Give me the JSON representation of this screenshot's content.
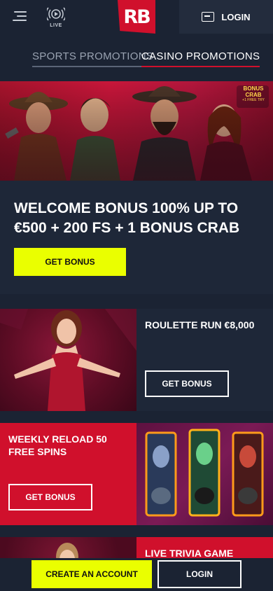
{
  "header": {
    "live_label": "LIVE",
    "logo_text": "RB",
    "login_label": "LOGIN"
  },
  "tabs": [
    {
      "label": "SPORTS PROMOTIONS",
      "active": false
    },
    {
      "label": "CASINO PROMOTIONS",
      "active": true
    }
  ],
  "hero": {
    "badge_title": "BONUS CRAB",
    "badge_sub": "+1 FREE TRY",
    "title": "WELCOME BONUS 100% UP TO €500 + 200 FS + 1 BONUS CRAB",
    "button_label": "GET BONUS"
  },
  "promos": [
    {
      "title": "ROULETTE RUN €8,000",
      "button_label": "GET BONUS"
    },
    {
      "title": "WEEKLY RELOAD 50 FREE SPINS",
      "button_label": "GET BONUS"
    },
    {
      "title": "LIVE TRIVIA GAME"
    }
  ],
  "footer": {
    "create_account_label": "CREATE AN ACCOUNT",
    "login_label": "LOGIN"
  },
  "colors": {
    "accent_red": "#d0102c",
    "accent_yellow": "#eaff00",
    "background": "#1b2333"
  }
}
